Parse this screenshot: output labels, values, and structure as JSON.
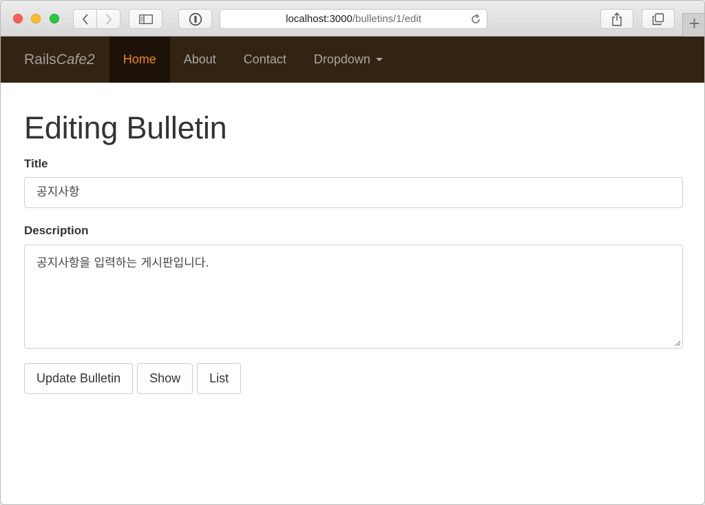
{
  "browser": {
    "url_host": "localhost:3000",
    "url_path": "/bulletins/1/edit",
    "new_tab_symbol": "+"
  },
  "navbar": {
    "brand_plain": "Rails",
    "brand_italic": "Cafe2",
    "items": [
      {
        "label": "Home",
        "active": true
      },
      {
        "label": "About",
        "active": false
      },
      {
        "label": "Contact",
        "active": false
      },
      {
        "label": "Dropdown",
        "active": false,
        "has_caret": true
      }
    ]
  },
  "page": {
    "title": "Editing Bulletin"
  },
  "form": {
    "title_label": "Title",
    "title_value": "공지사항",
    "description_label": "Description",
    "description_value": "공지사항을 입력하는 게시판입니다."
  },
  "actions": {
    "update_label": "Update Bulletin",
    "show_label": "Show",
    "list_label": "List"
  },
  "colors": {
    "navbar_bg": "#332313",
    "navbar_active_bg": "#1c1208",
    "navbar_active_text": "#ef8a13",
    "navbar_text": "#a9a6a2"
  },
  "icons": [
    "back-icon",
    "forward-icon",
    "sidebar-icon",
    "password-icon",
    "reload-icon",
    "share-icon",
    "tabs-icon",
    "caret-down-icon",
    "resize-grip-icon"
  ]
}
